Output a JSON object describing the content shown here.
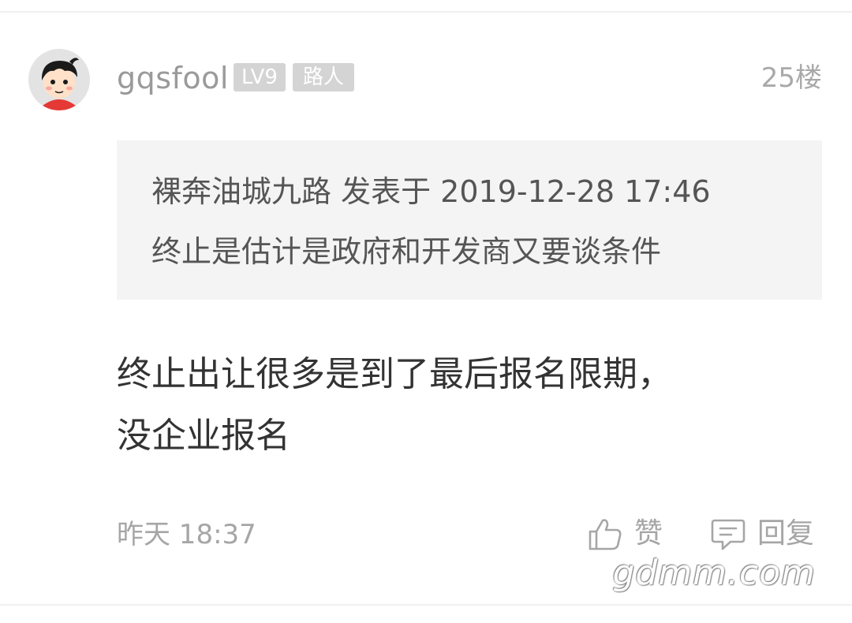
{
  "post": {
    "author": {
      "name": "gqsfool",
      "level": "LV9",
      "role": "路人",
      "avatar_icon": "cartoon-boy-avatar"
    },
    "floor": "25楼",
    "quote": {
      "meta": "裸奔油城九路 发表于 2019-12-28 17:46",
      "text": "终止是估计是政府和开发商又要谈条件"
    },
    "content_lines": [
      "终止出让很多是到了最后报名限期，",
      "没企业报名"
    ],
    "time": "昨天 18:37",
    "actions": {
      "like_label": "赞",
      "like_icon": "thumbs-up-icon",
      "reply_label": "回复",
      "reply_icon": "comment-icon"
    }
  },
  "watermark": "gdmm.com",
  "colors": {
    "meta_gray": "#a6a6a6",
    "badge_bg": "#d4d4d4",
    "quote_bg": "#f4f4f4",
    "content_text": "#333333"
  }
}
